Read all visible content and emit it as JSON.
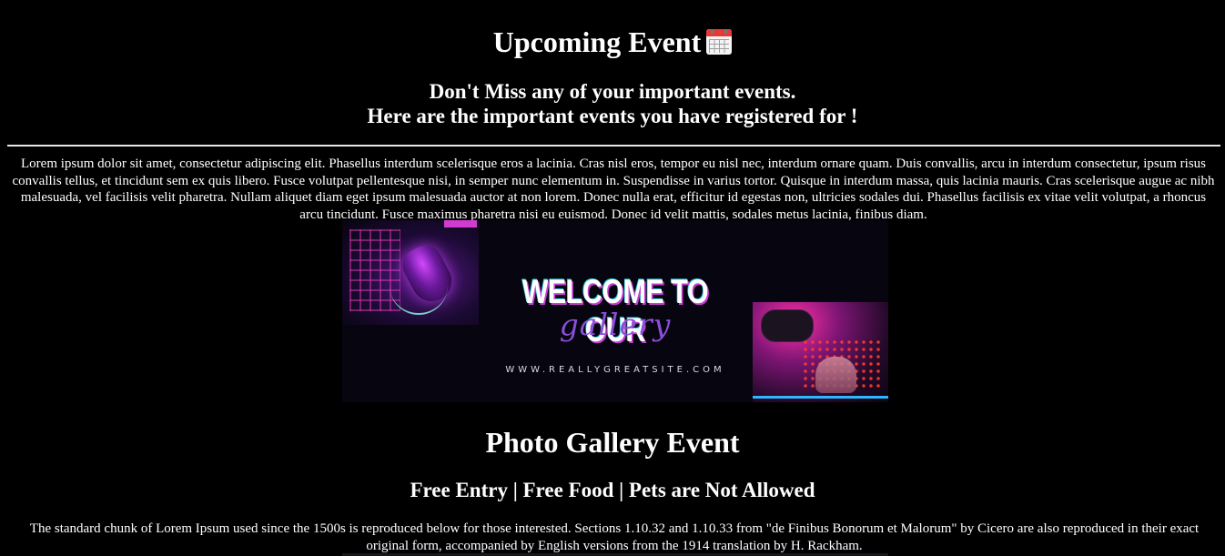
{
  "header": {
    "title": "Upcoming Event",
    "title_icon": "calendar-icon",
    "subtitle_line1": "Don't Miss any of your important events.",
    "subtitle_line2": "Here are the important events you have registered for !"
  },
  "intro": {
    "paragraph": "Lorem ipsum dolor sit amet, consectetur adipiscing elit. Phasellus interdum scelerisque eros a lacinia. Cras nisl eros, tempor eu nisl nec, interdum ornare quam. Duis convallis, arcu in interdum consectetur, ipsum risus convallis tellus, et tincidunt sem ex quis libero. Fusce volutpat pellentesque nisi, in semper nunc elementum in. Suspendisse in varius tortor. Quisque in interdum massa, quis lacinia mauris. Cras scelerisque augue ac nibh malesuada, vel facilisis velit pharetra. Nullam aliquet diam eget ipsum malesuada auctor at non lorem. Donec nulla erat, efficitur id egestas non, ultricies sodales dui. Phasellus facilisis ex vitae velit volutpat, a rhoncus arcu tincidunt. Fusce maximus pharetra nisi eu euismod. Donec id velit mattis, sodales metus lacinia, finibus diam."
  },
  "banner": {
    "headline": "WELCOME TO OUR",
    "script_word": "gallery",
    "website": "WWW.REALLYGREATSITE.COM"
  },
  "event": {
    "title": "Photo Gallery Event",
    "details": "Free Entry | Free Food | Pets are Not Allowed",
    "description": "The standard chunk of Lorem Ipsum used since the 1500s is reproduced below for those interested. Sections 1.10.32 and 1.10.33 from \"de Finibus Bonorum et Malorum\" by Cicero are also reproduced in their exact original form, accompanied by English versions from the 1914 translation by H. Rackham."
  }
}
